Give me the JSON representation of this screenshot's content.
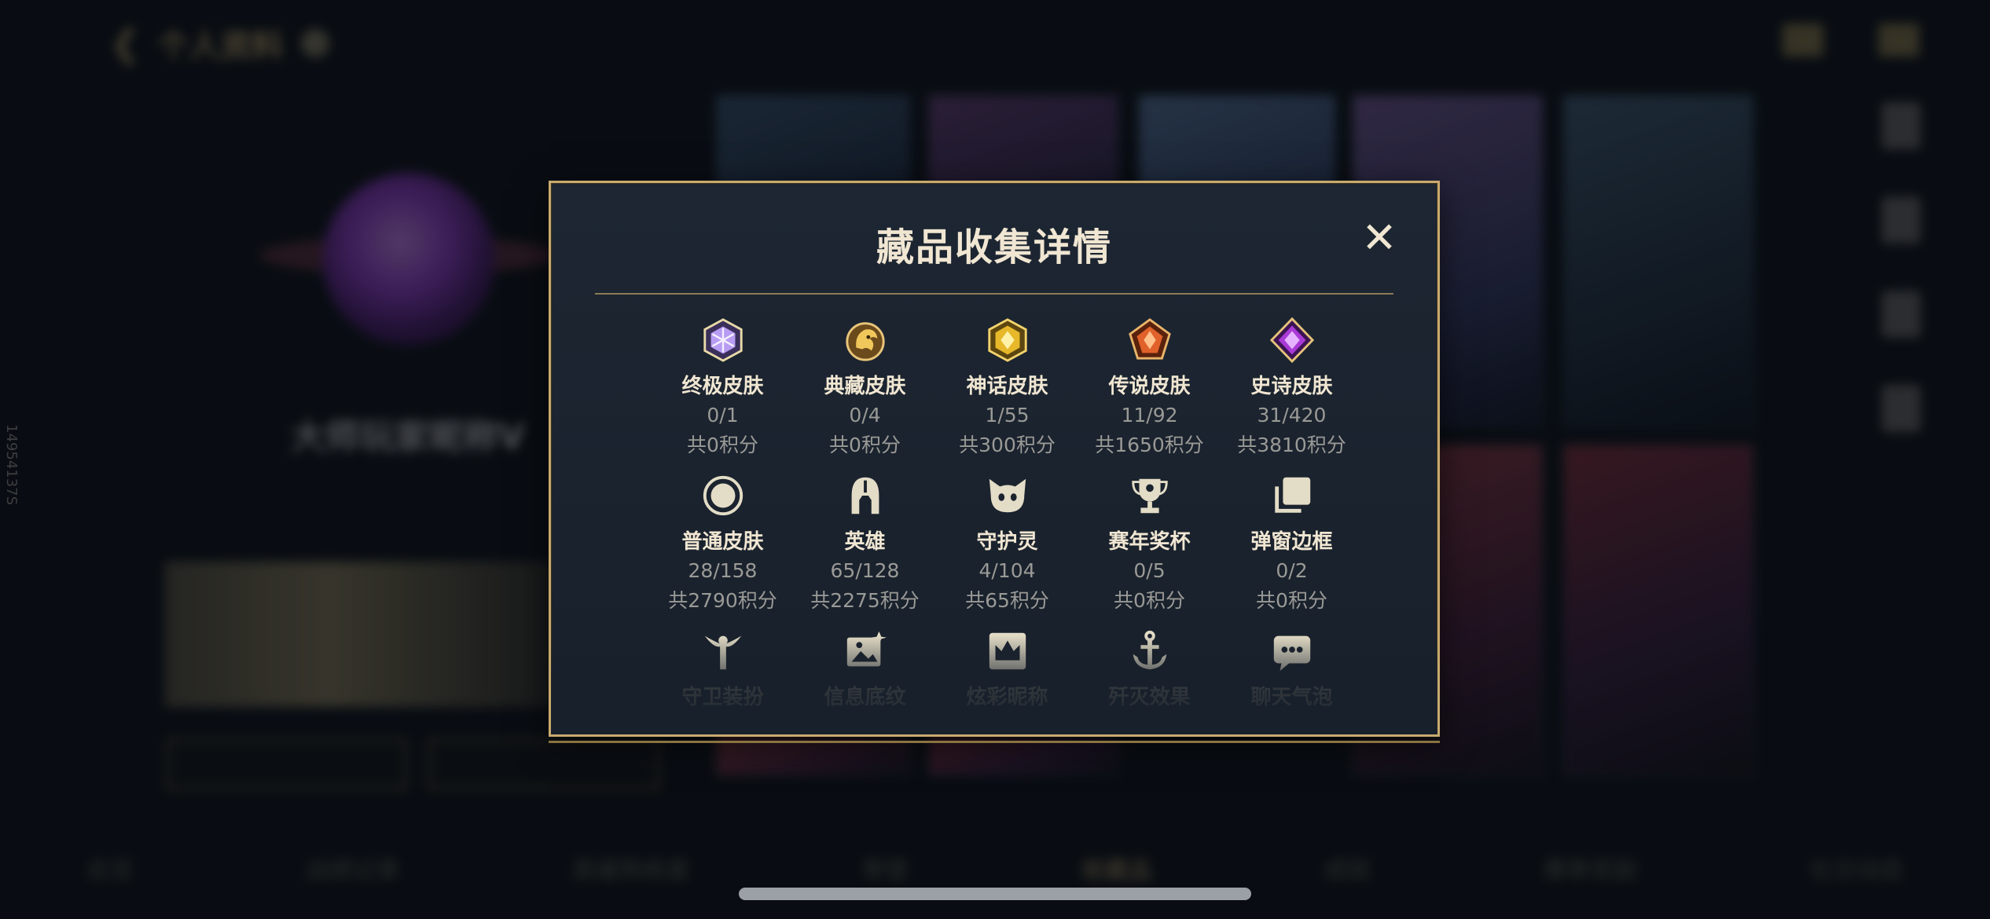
{
  "background": {
    "top_title": "个人资料",
    "player_name": "大师玩家昵称V",
    "bottom_nav": [
      "总览",
      "战绩记录",
      "英雄熟练度",
      "荣誉",
      "收藏品",
      "成就",
      "赛季奖励",
      "社交动态"
    ],
    "side_id": "14954137S"
  },
  "modal": {
    "title": "藏品收集详情",
    "close_icon": "close-icon",
    "items": [
      {
        "name": "终极皮肤",
        "count": "0/1",
        "points": "共0积分",
        "icon": "ultimate-skin-icon",
        "color": "#b79cf2"
      },
      {
        "name": "典藏皮肤",
        "count": "0/4",
        "points": "共0积分",
        "icon": "prestige-skin-icon",
        "color": "#d7a84a"
      },
      {
        "name": "神话皮肤",
        "count": "1/55",
        "points": "共300积分",
        "icon": "mythic-skin-icon",
        "color": "#e6b82a"
      },
      {
        "name": "传说皮肤",
        "count": "11/92",
        "points": "共1650积分",
        "icon": "legendary-skin-icon",
        "color": "#e0612a"
      },
      {
        "name": "史诗皮肤",
        "count": "31/420",
        "points": "共3810积分",
        "icon": "epic-skin-icon",
        "color": "#a93ad6"
      },
      {
        "name": "普通皮肤",
        "count": "28/158",
        "points": "共2790积分",
        "icon": "standard-skin-icon",
        "color": "#d8cfae"
      },
      {
        "name": "英雄",
        "count": "65/128",
        "points": "共2275积分",
        "icon": "champion-helmet-icon",
        "color": "#d8cfae"
      },
      {
        "name": "守护灵",
        "count": "4/104",
        "points": "共65积分",
        "icon": "pet-icon",
        "color": "#d8cfae"
      },
      {
        "name": "赛年奖杯",
        "count": "0/5",
        "points": "共0积分",
        "icon": "trophy-icon",
        "color": "#d8cfae"
      },
      {
        "name": "弹窗边框",
        "count": "0/2",
        "points": "共0积分",
        "icon": "frame-icon",
        "color": "#d8cfae"
      },
      {
        "name": "守卫装扮",
        "count": "",
        "points": "",
        "icon": "ward-skin-icon",
        "color": "#d8cfae"
      },
      {
        "name": "信息底纹",
        "count": "",
        "points": "",
        "icon": "banner-icon",
        "color": "#d8cfae"
      },
      {
        "name": "炫彩昵称",
        "count": "",
        "points": "",
        "icon": "crown-name-icon",
        "color": "#d8cfae"
      },
      {
        "name": "歼灭效果",
        "count": "",
        "points": "",
        "icon": "anchor-effect-icon",
        "color": "#d8cfae"
      },
      {
        "name": "聊天气泡",
        "count": "",
        "points": "",
        "icon": "chat-bubble-icon",
        "color": "#d8cfae"
      }
    ]
  }
}
